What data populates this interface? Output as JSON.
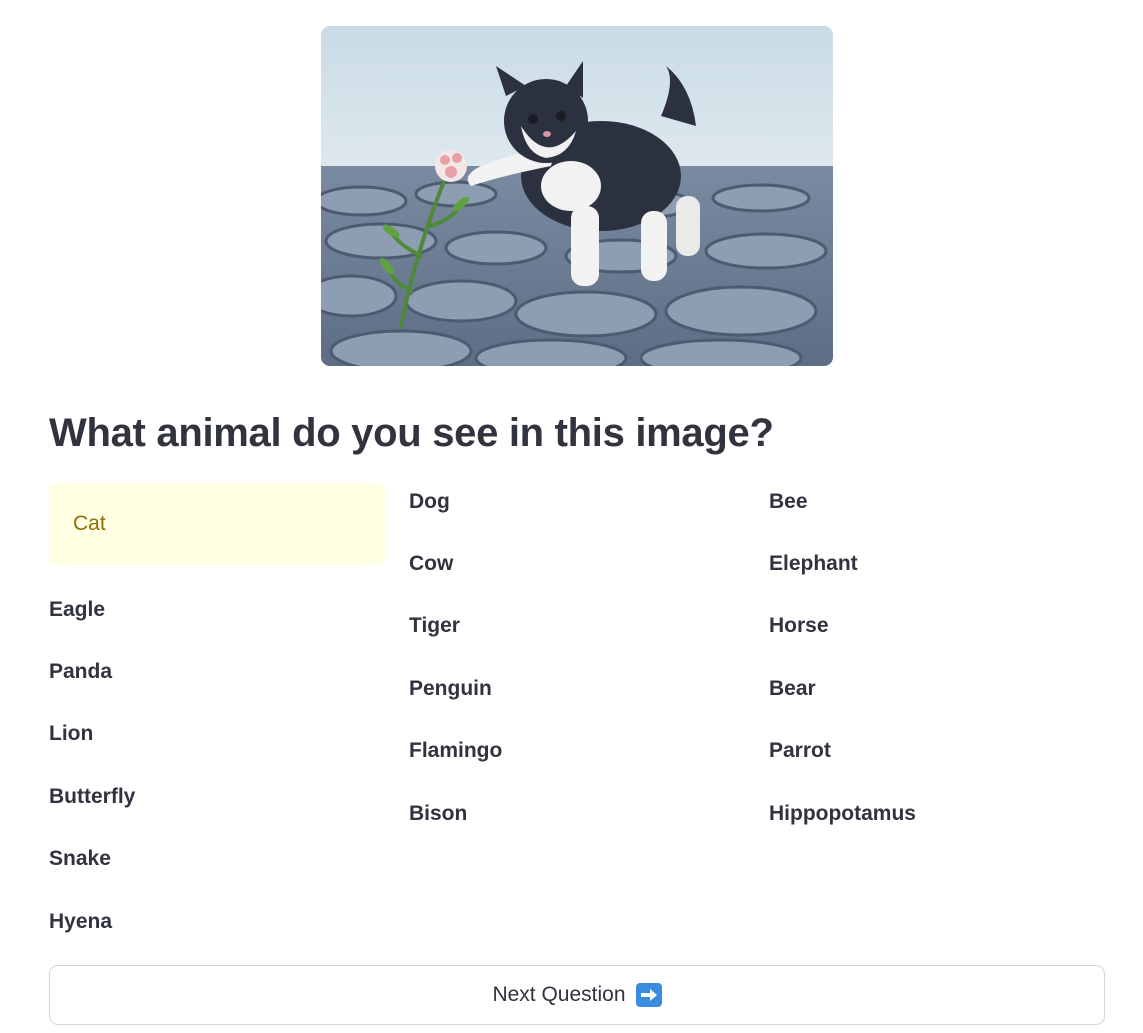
{
  "image": {
    "subject": "kitten"
  },
  "question": {
    "text": "What animal do you see in this image?"
  },
  "options": {
    "column_1": [
      "Cat",
      "Eagle",
      "Panda",
      "Lion",
      "Butterfly",
      "Snake",
      "Hyena"
    ],
    "column_2": [
      "Dog",
      "Cow",
      "Tiger",
      "Penguin",
      "Flamingo",
      "Bison"
    ],
    "column_3": [
      "Bee",
      "Elephant",
      "Horse",
      "Bear",
      "Parrot",
      "Hippopotamus"
    ],
    "selected": "Cat"
  },
  "next_button": {
    "label": "Next Question",
    "icon": "right-arrow-icon"
  },
  "colors": {
    "text": "#31333f",
    "selected_background": "#ffffe4",
    "selected_text": "#926c05",
    "arrow_badge": "#3a8dde"
  }
}
